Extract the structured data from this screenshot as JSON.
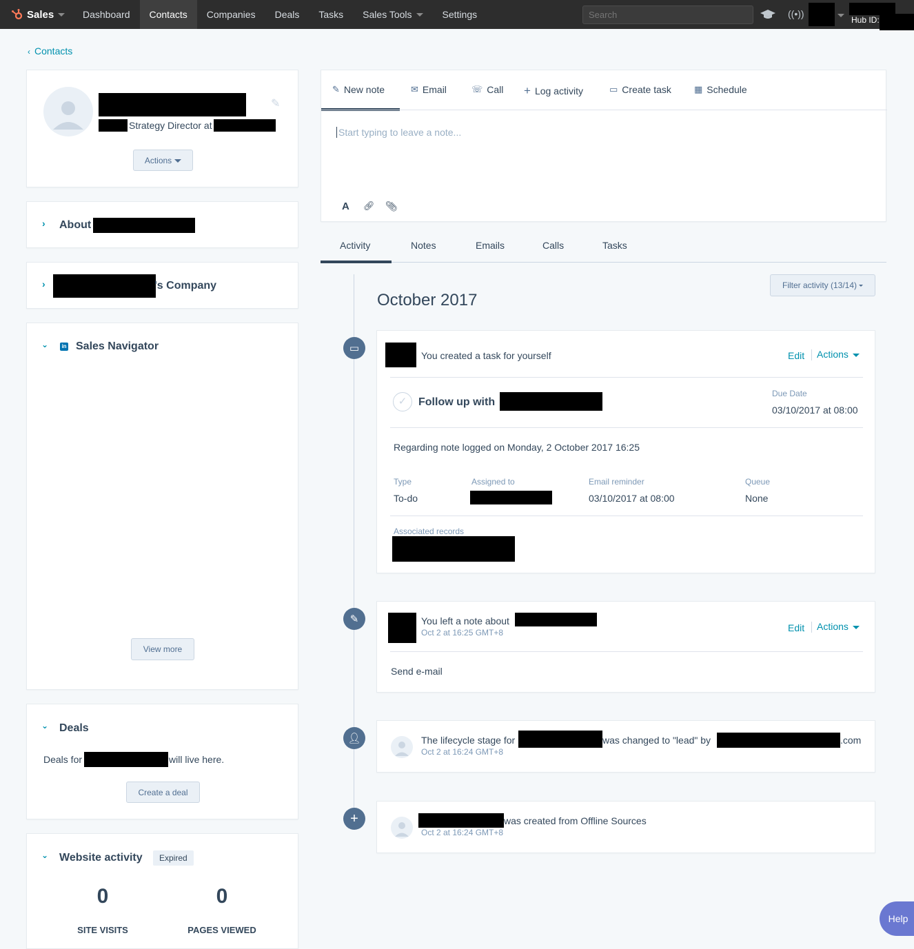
{
  "nav": {
    "brand": "Sales",
    "items": [
      "Dashboard",
      "Contacts",
      "Companies",
      "Deals",
      "Tasks",
      "Sales Tools",
      "Settings"
    ],
    "search_placeholder": "Search",
    "hub_id_label": "Hub ID:"
  },
  "back_link": "Contacts",
  "profile": {
    "job_title": "Strategy Director at",
    "actions_label": "Actions"
  },
  "sections": {
    "about_label": "About",
    "company_suffix": "'s Company",
    "sales_navigator_title": "Sales Navigator",
    "view_more": "View more",
    "deals_title": "Deals",
    "deals_prefix": "Deals for",
    "deals_suffix": "will live here.",
    "create_deal": "Create a deal",
    "website_activity_title": "Website activity",
    "expired_badge": "Expired",
    "site_visits_value": "0",
    "site_visits_label": "SITE VISITS",
    "pages_viewed_value": "0",
    "pages_viewed_label": "PAGES VIEWED"
  },
  "composer": {
    "tabs": [
      "New note",
      "Email",
      "Call",
      "Log activity",
      "Create task",
      "Schedule"
    ],
    "placeholder": "Start typing to leave a note..."
  },
  "activity_tabs": [
    "Activity",
    "Notes",
    "Emails",
    "Calls",
    "Tasks"
  ],
  "filter_label": "Filter activity (13/14)",
  "month_heading": "October 2017",
  "task_card": {
    "header_text": "You created a task for yourself",
    "edit": "Edit",
    "actions": "Actions",
    "follow_up_prefix": "Follow up with",
    "due_date_label": "Due Date",
    "due_date_value": "03/10/2017 at 08:00",
    "regarding": "Regarding note logged on Monday, 2 October 2017 16:25",
    "type_label": "Type",
    "type_value": "To-do",
    "assigned_label": "Assigned to",
    "reminder_label": "Email reminder",
    "reminder_value": "03/10/2017 at 08:00",
    "queue_label": "Queue",
    "queue_value": "None",
    "associated_label": "Associated records"
  },
  "note_card": {
    "header_text": "You left a note about",
    "timestamp": "Oct 2 at 16:25 GMT+8",
    "edit": "Edit",
    "actions": "Actions",
    "body": "Send e-mail"
  },
  "lifecycle_card": {
    "prefix": "The lifecycle stage for",
    "middle": "was changed to \"lead\" by",
    "suffix": ".com",
    "timestamp": "Oct 2 at 16:24 GMT+8"
  },
  "created_card": {
    "text": "was created from Offline Sources",
    "timestamp": "Oct 2 at 16:24 GMT+8"
  },
  "help_label": "Help"
}
